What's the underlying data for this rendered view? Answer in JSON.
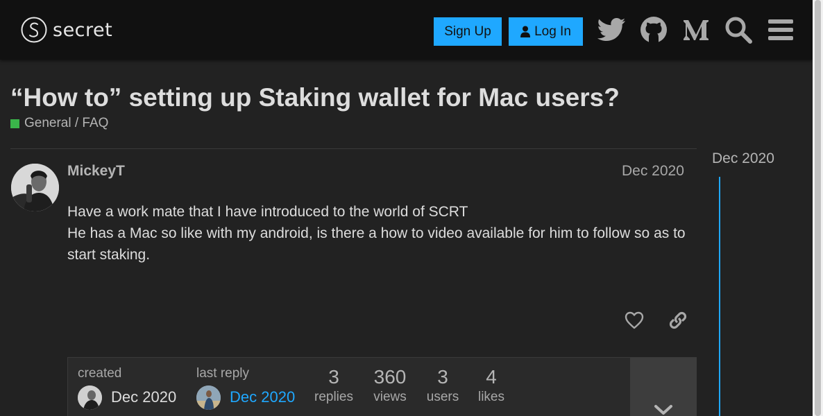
{
  "header": {
    "logo_text": "secret",
    "signup_label": "Sign Up",
    "login_label": "Log In",
    "icons": [
      "twitter-icon",
      "github-icon",
      "medium-icon",
      "search-icon",
      "hamburger-menu-icon"
    ],
    "accent": "#1fa8ff"
  },
  "topic": {
    "title": "“How to” setting up Staking wallet for Mac users?",
    "category": "General / FAQ",
    "category_color": "#3ab54a"
  },
  "post": {
    "username": "MickeyT",
    "date": "Dec 2020",
    "lines": [
      "Have a work mate that I have introduced to the world of SCRT",
      "He has a Mac so like with my android, is there a how to video available for him to follow so as to start staking."
    ]
  },
  "topic_map": {
    "created_label": "created",
    "created_date": "Dec 2020",
    "last_reply_label": "last reply",
    "last_reply_date": "Dec 2020",
    "stats": [
      {
        "value": "3",
        "label": "replies"
      },
      {
        "value": "360",
        "label": "views"
      },
      {
        "value": "3",
        "label": "users"
      },
      {
        "value": "4",
        "label": "likes"
      }
    ]
  },
  "timeline": {
    "date": "Dec 2020"
  }
}
